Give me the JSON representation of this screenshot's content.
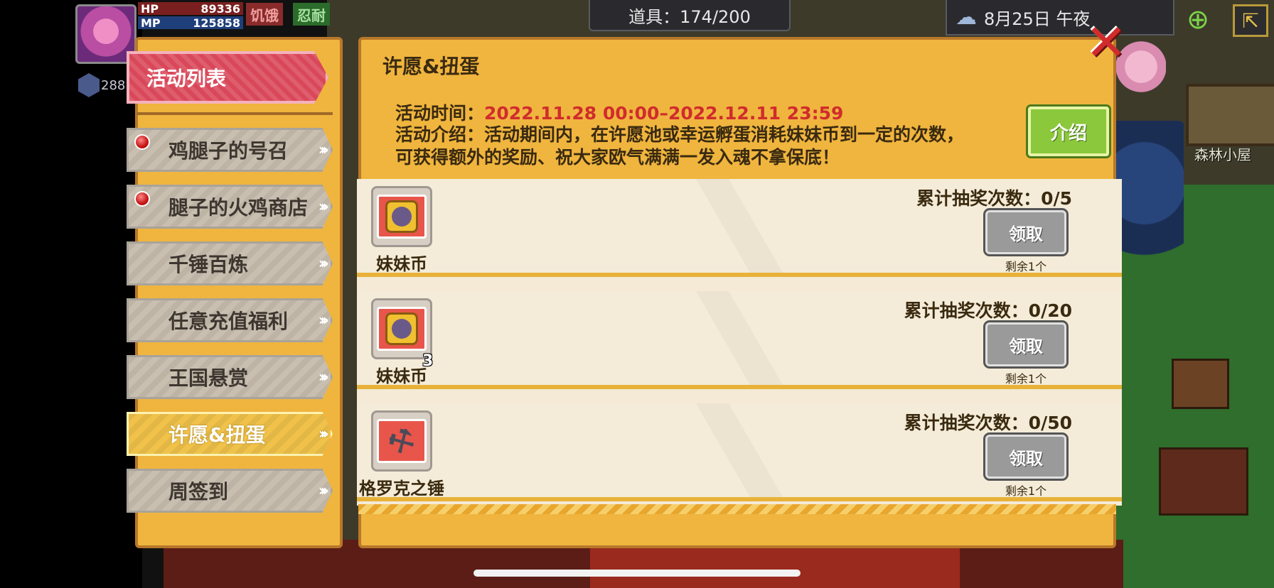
{
  "hud": {
    "hp_label": "HP",
    "hp_value": "89336",
    "mp_label": "MP",
    "mp_value": "125858",
    "hunger_tag": "饥饿",
    "endure_tag": "忍耐",
    "level": "288",
    "items": "道具：174/200",
    "date": "8月25日 午夜",
    "forest_label": "森林小屋"
  },
  "left_panel": {
    "title": "活动列表",
    "tabs": [
      {
        "label": "鸡腿子的号召",
        "dot": true,
        "active": false
      },
      {
        "label": "腿子的火鸡商店",
        "dot": true,
        "active": false
      },
      {
        "label": "千锤百炼",
        "dot": false,
        "active": false
      },
      {
        "label": "任意充值福利",
        "dot": false,
        "active": false
      },
      {
        "label": "王国悬赏",
        "dot": false,
        "active": false
      },
      {
        "label": "许愿&扭蛋",
        "dot": false,
        "active": true
      },
      {
        "label": "周签到",
        "dot": false,
        "active": false
      }
    ]
  },
  "main_panel": {
    "title": "许愿&扭蛋",
    "time_label": "活动时间：",
    "time_value": "2022.11.28 00:00–2022.12.11 23:59",
    "desc_line1": "活动介绍：活动期间内，在许愿池或幸运孵蛋消耗妹妹币到一定的次数，",
    "desc_line2": "可获得额外的奖励、祝大家欧气满满一发入魂不拿保底！",
    "intro_button": "介绍"
  },
  "rewards": [
    {
      "item": "妹妹币",
      "count": "",
      "progress": "累计抽奖次数：0/5",
      "button": "领取",
      "remaining": "剩余1个"
    },
    {
      "item": "妹妹币",
      "count": "3",
      "progress": "累计抽奖次数：0/20",
      "button": "领取",
      "remaining": "剩余1个"
    },
    {
      "item": "格罗克之锤",
      "count": "",
      "progress": "累计抽奖次数：0/50",
      "button": "领取",
      "remaining": "剩余1个"
    }
  ],
  "colors": {
    "panel": "#f0b53e",
    "title_red": "#d9485a",
    "time_red": "#d02c2c",
    "intro_green": "#8bc83c",
    "claim_gray": "#9a9a9a"
  }
}
